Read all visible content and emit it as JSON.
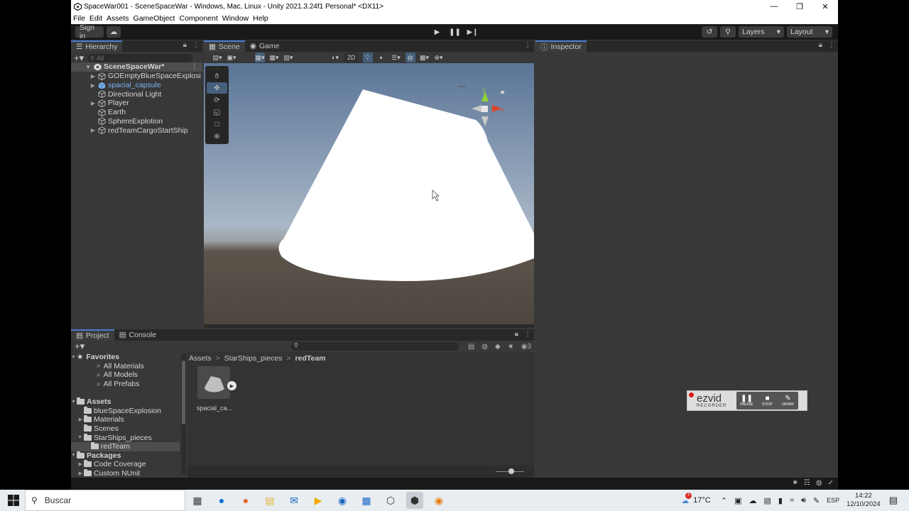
{
  "window": {
    "title": "SpaceWar001 - SceneSpaceWar - Windows, Mac, Linux - Unity 2021.3.24f1 Personal* <DX11>",
    "menu": [
      "File",
      "Edit",
      "Assets",
      "GameObject",
      "Component",
      "Window",
      "Help"
    ]
  },
  "toolbar": {
    "sign_in": "Sign in",
    "layers": "Layers",
    "layout": "Layout"
  },
  "hierarchy": {
    "tab": "Hierarchy",
    "search_placeholder": "All",
    "scene_name": "SceneSpaceWar*",
    "items": [
      {
        "label": "GOEmptyBlueSpaceExplosi",
        "expandable": true,
        "prefab": false
      },
      {
        "label": "spacial_capsule",
        "expandable": true,
        "prefab": true
      },
      {
        "label": "Directional Light",
        "expandable": false,
        "prefab": false
      },
      {
        "label": "Player",
        "expandable": true,
        "prefab": false
      },
      {
        "label": "Earth",
        "expandable": false,
        "prefab": false
      },
      {
        "label": "SphereExplotion",
        "expandable": false,
        "prefab": false
      },
      {
        "label": "redTeamCargoStartShip",
        "expandable": true,
        "prefab": false
      }
    ]
  },
  "scene": {
    "tabs": [
      "Scene",
      "Game"
    ],
    "mode_2d": "2D",
    "gizmo_y": "y",
    "gizmo_x": "x"
  },
  "inspector": {
    "tab": "Inspector"
  },
  "project": {
    "tabs": [
      "Project",
      "Console"
    ],
    "hidden_count": "3",
    "favorites_label": "Favorites",
    "favorites": [
      "All Materials",
      "All Models",
      "All Prefabs"
    ],
    "assets_label": "Assets",
    "assets_children": [
      "blueSpaceExplosion",
      "Materials",
      "Scenes",
      "StarShips_pieces"
    ],
    "selected_folder": "redTeam",
    "packages_label": "Packages",
    "packages": [
      "Code Coverage",
      "Custom NUnit"
    ],
    "breadcrumb": [
      "Assets",
      "StarShips_pieces",
      "redTeam"
    ],
    "asset_name": "spacial_ca..."
  },
  "ezvid": {
    "brand": "ezvid",
    "sub": "RECORDER",
    "buttons": [
      "PAUSE",
      "STOP",
      "DRAW"
    ]
  },
  "taskbar": {
    "search_placeholder": "Buscar",
    "weather": "17°C",
    "lang": "ESP",
    "time": "14:22",
    "date": "12/10/2024",
    "weather_badge": "1"
  },
  "colors": {
    "accent": "#4a7bd0",
    "prefab_text": "#7cb1f0",
    "sky_top": "#5e7b9c",
    "ground": "#4f4840"
  }
}
